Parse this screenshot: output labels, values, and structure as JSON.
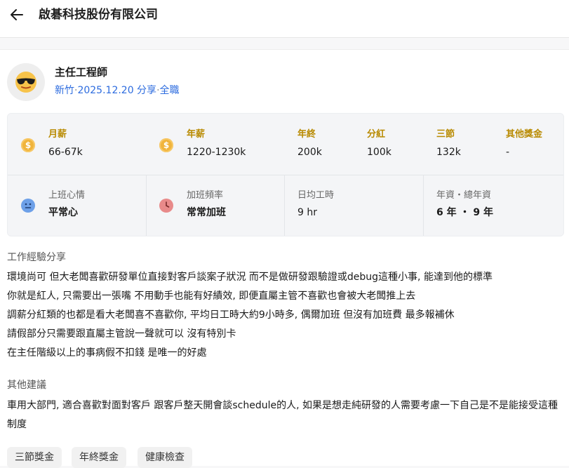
{
  "header": {
    "company": "啟碁科技股份有限公司",
    "back_icon": "arrow-left-icon"
  },
  "post": {
    "avatar_icon": "sunglasses-emoji-icon",
    "job_title": "主任工程師",
    "location": "新竹",
    "date": "2025.12.20 分享",
    "employment_type": "全職",
    "separator": "·"
  },
  "compensation": [
    {
      "label": "月薪",
      "value": "66-67k",
      "icon": "coin-icon"
    },
    {
      "label": "年薪",
      "value": "1220-1230k",
      "icon": "coin-icon"
    },
    {
      "label": "年終",
      "value": "200k"
    },
    {
      "label": "分紅",
      "value": "100k"
    },
    {
      "label": "三節",
      "value": "132k"
    },
    {
      "label": "其他獎金",
      "value": "-"
    }
  ],
  "work_stats": [
    {
      "label": "上班心情",
      "value": "平常心",
      "icon": "neutral-face-icon"
    },
    {
      "label": "加班頻率",
      "value": "常常加班",
      "icon": "clock-icon"
    },
    {
      "label": "日均工時",
      "value": "9 hr"
    },
    {
      "label": "年資・總年資",
      "value": "6 年 ・ 9 年"
    }
  ],
  "experience": {
    "title": "工作經驗分享",
    "lines": [
      "環境尚可 但大老闆喜歡研發單位直接對客戶談案子狀況 而不是做研發跟驗證或debug這種小事, 能達到他的標準",
      "你就是紅人, 只需要出一張嘴 不用動手也能有好績效, 即便直屬主管不喜歡也會被大老闆推上去",
      "調薪分紅類的也都是看大老闆喜不喜歡你, 平均日工時大約9小時多, 偶爾加班 但沒有加班費 最多報補休",
      "請假部分只需要跟直屬主管說一聲就可以 沒有特別卡",
      "在主任階級以上的事病假不扣錢 是唯一的好處"
    ]
  },
  "suggestions": {
    "title": "其他建議",
    "text": "車用大部門, 適合喜歡對面對客戶 跟客戶整天開會談schedule的人, 如果是想走純研發的人需要考慮一下自己是不是能接受這種制度"
  },
  "tags": [
    "三節獎金",
    "年終獎金",
    "健康檢查"
  ],
  "colors": {
    "accent_blue": "#2d6cdf",
    "gold_label": "#b88a00",
    "coin": "#f0b43c"
  }
}
